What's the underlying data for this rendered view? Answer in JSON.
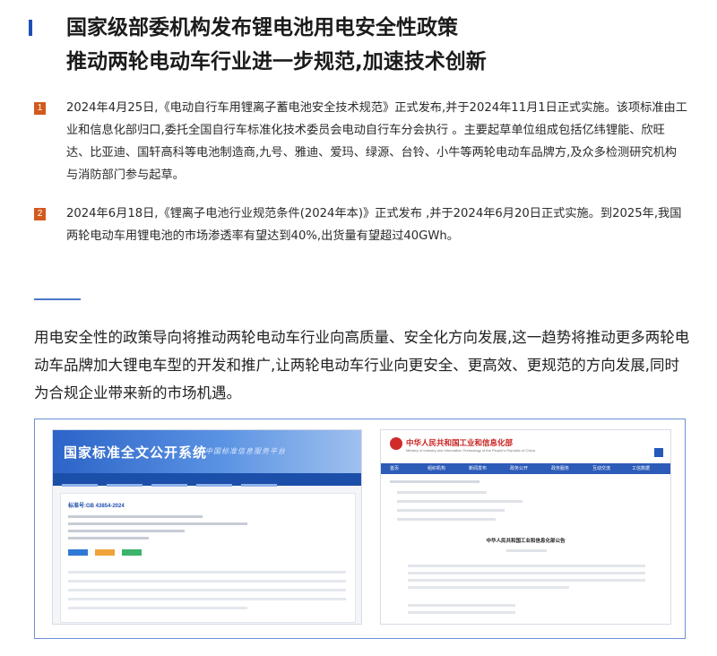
{
  "title": {
    "line1": "国家级部委机构发布锂电池用电安全性政策",
    "line2": "推动两轮电动车行业进一步规范,加速技术创新"
  },
  "items": [
    {
      "number": "1",
      "text": "2024年4月25日,《电动自行车用锂离子蓄电池安全技术规范》正式发布,并于2024年11月1日正式实施。该项标准由工业和信息化部归口,委托全国自行车标准化技术委员会电动自行车分会执行 。主要起草单位组成包括亿纬锂能、欣旺达、比亚迪、国轩高科等电池制造商,九号、雅迪、爱玛、绿源、台铃、小牛等两轮电动车品牌方,及众多检测研究机构与消防部门参与起草。"
    },
    {
      "number": "2",
      "text": "2024年6月18日,《锂离子电池行业规范条件(2024年本)》正式发布 ,并于2024年6月20日正式实施。到2025年,我国两轮电动车用锂电池的市场渗透率有望达到40%,出货量有望超过40GWh。"
    }
  ],
  "summary": "用电安全性的政策导向将推动两轮电动车行业向高质量、安全化方向发展,这一趋势将推动更多两轮电动车品牌加大锂电车型的开发和推广,让两轮电动车行业向更安全、更高效、更规范的方向发展,同时为合规企业带来新的市场机遇。",
  "screenshots": {
    "left": {
      "site_title": "国家标准全文公开系统",
      "tagline": "中国标准信息服务平台",
      "standard_code": "标准号:GB 43854-2024",
      "buttons": [
        "#2f78d6",
        "#f0a23b",
        "#3bb36a"
      ]
    },
    "right": {
      "site_title": "中华人民共和国工业和信息化部",
      "site_en": "Ministry of Industry and Information Technology of the People's Republic of China",
      "nav": [
        "首页",
        "组织机构",
        "新闻发布",
        "政务公开",
        "政务服务",
        "互动交流",
        "工信数据"
      ],
      "doc_title": "中华人民共和国工业和信息化部公告"
    }
  }
}
